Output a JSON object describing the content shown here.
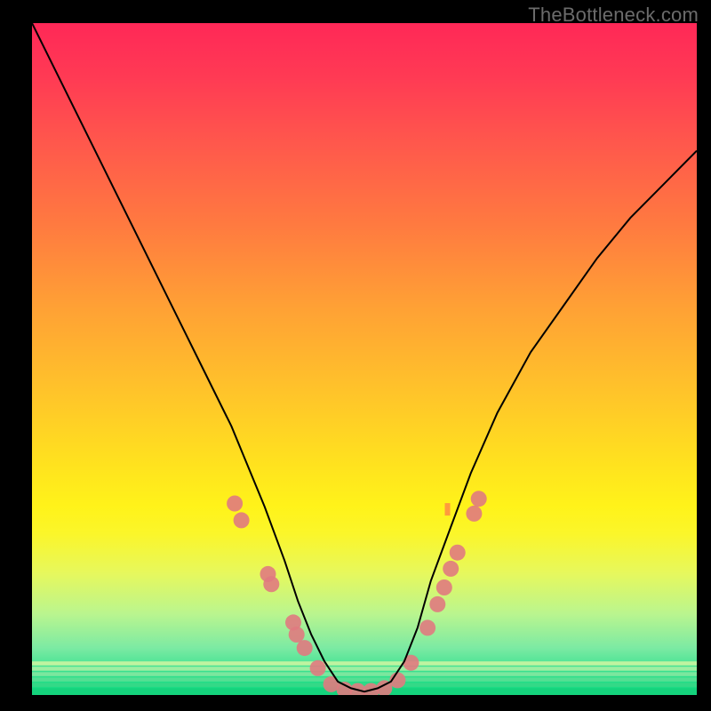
{
  "watermark": "TheBottleneck.com",
  "chart_data": {
    "type": "line",
    "title": "",
    "xlabel": "",
    "ylabel": "",
    "xlim": [
      0,
      1
    ],
    "ylim": [
      0,
      1
    ],
    "grid": false,
    "legend": false,
    "series": [
      {
        "name": "curve",
        "stroke": "#000000",
        "x": [
          0.0,
          0.05,
          0.1,
          0.15,
          0.2,
          0.25,
          0.3,
          0.35,
          0.38,
          0.4,
          0.42,
          0.44,
          0.46,
          0.48,
          0.5,
          0.52,
          0.54,
          0.56,
          0.58,
          0.6,
          0.63,
          0.66,
          0.7,
          0.75,
          0.8,
          0.85,
          0.9,
          0.95,
          1.0
        ],
        "y": [
          1.0,
          0.9,
          0.8,
          0.7,
          0.6,
          0.5,
          0.4,
          0.28,
          0.2,
          0.14,
          0.09,
          0.05,
          0.02,
          0.01,
          0.005,
          0.01,
          0.02,
          0.05,
          0.1,
          0.17,
          0.25,
          0.33,
          0.42,
          0.51,
          0.58,
          0.65,
          0.71,
          0.76,
          0.81
        ]
      }
    ],
    "markers": [
      {
        "name": "dots",
        "fill": "#e07a80",
        "radius": 9,
        "points": [
          {
            "x": 0.305,
            "y": 0.285
          },
          {
            "x": 0.315,
            "y": 0.26
          },
          {
            "x": 0.355,
            "y": 0.18
          },
          {
            "x": 0.36,
            "y": 0.165
          },
          {
            "x": 0.393,
            "y": 0.108
          },
          {
            "x": 0.398,
            "y": 0.09
          },
          {
            "x": 0.41,
            "y": 0.07
          },
          {
            "x": 0.43,
            "y": 0.04
          },
          {
            "x": 0.45,
            "y": 0.016
          },
          {
            "x": 0.47,
            "y": 0.008
          },
          {
            "x": 0.49,
            "y": 0.006
          },
          {
            "x": 0.51,
            "y": 0.006
          },
          {
            "x": 0.53,
            "y": 0.01
          },
          {
            "x": 0.55,
            "y": 0.022
          },
          {
            "x": 0.57,
            "y": 0.048
          },
          {
            "x": 0.595,
            "y": 0.1
          },
          {
            "x": 0.61,
            "y": 0.135
          },
          {
            "x": 0.62,
            "y": 0.16
          },
          {
            "x": 0.63,
            "y": 0.188
          },
          {
            "x": 0.64,
            "y": 0.212
          },
          {
            "x": 0.665,
            "y": 0.27
          },
          {
            "x": 0.672,
            "y": 0.292
          }
        ]
      }
    ],
    "annotations": [
      {
        "name": "orange-blip",
        "x": 0.625,
        "y": 0.275,
        "color": "#ff9a3d"
      }
    ]
  }
}
